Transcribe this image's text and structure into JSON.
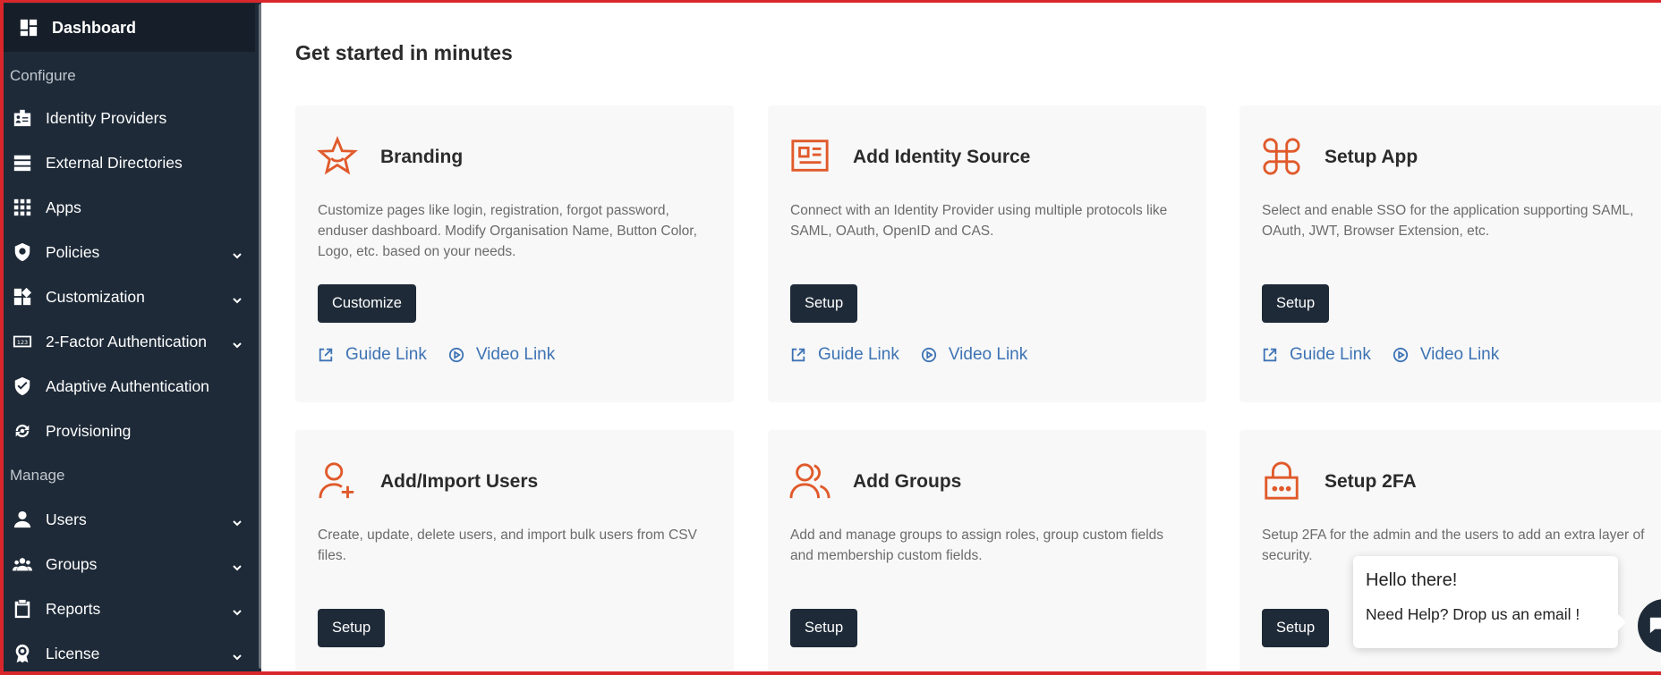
{
  "sidebar": {
    "dashboard_label": "Dashboard",
    "section_configure": "Configure",
    "section_manage": "Manage",
    "items": [
      {
        "label": "Identity Providers",
        "icon": "id-badge-icon",
        "chevron": false
      },
      {
        "label": "External Directories",
        "icon": "directory-icon",
        "chevron": false
      },
      {
        "label": "Apps",
        "icon": "apps-grid-icon",
        "chevron": false
      },
      {
        "label": "Policies",
        "icon": "policy-shield-icon",
        "chevron": true
      },
      {
        "label": "Customization",
        "icon": "widgets-icon",
        "chevron": true
      },
      {
        "label": "2-Factor Authentication",
        "icon": "numeric-123-icon",
        "chevron": true
      },
      {
        "label": "Adaptive Authentication",
        "icon": "shield-check-icon",
        "chevron": false
      },
      {
        "label": "Provisioning",
        "icon": "provisioning-icon",
        "chevron": false
      },
      {
        "label": "Users",
        "icon": "user-icon",
        "chevron": true
      },
      {
        "label": "Groups",
        "icon": "groups-icon",
        "chevron": true
      },
      {
        "label": "Reports",
        "icon": "clipboard-icon",
        "chevron": true
      },
      {
        "label": "License",
        "icon": "license-icon",
        "chevron": true
      }
    ]
  },
  "main": {
    "title": "Get started in minutes",
    "cards": [
      {
        "title": "Branding",
        "icon": "star-icon",
        "description": "Customize pages like login, registration, forgot password, enduser dashboard. Modify Organisation Name, Button Color, Logo, etc. based on your needs.",
        "button": "Customize",
        "guide": "Guide Link",
        "video": "Video Link"
      },
      {
        "title": "Add Identity Source",
        "icon": "id-card-icon",
        "description": "Connect with an Identity Provider using multiple protocols like SAML, OAuth, OpenID and CAS.",
        "button": "Setup",
        "guide": "Guide Link",
        "video": "Video Link"
      },
      {
        "title": "Setup App",
        "icon": "command-icon",
        "description": "Select and enable SSO for the application supporting SAML, OAuth, JWT, Browser Extension, etc.",
        "button": "Setup",
        "guide": "Guide Link",
        "video": "Video Link"
      },
      {
        "title": "Add/Import Users",
        "icon": "user-plus-icon",
        "description": "Create, update, delete users, and import bulk users from CSV files.",
        "button": "Setup"
      },
      {
        "title": "Add Groups",
        "icon": "users-icon",
        "description": "Add and manage groups to assign roles, group custom fields and membership custom fields.",
        "button": "Setup"
      },
      {
        "title": "Setup 2FA",
        "icon": "lock-icon",
        "description": "Setup 2FA for the admin and the users to add an extra layer of security.",
        "button": "Setup"
      }
    ]
  },
  "chat": {
    "greeting": "Hello there!",
    "message": "Need Help? Drop us an email !"
  },
  "colors": {
    "sidebar_bg": "#1e2a38",
    "accent_orange": "#e05a2b",
    "link_blue": "#3d73b4",
    "frame_red": "#d9262b"
  }
}
